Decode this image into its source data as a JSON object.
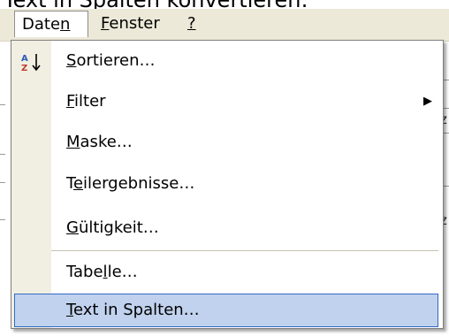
{
  "caption": "Text in Spalten konvertieren:",
  "menubar": {
    "daten": {
      "pre": "Date",
      "ul": "n",
      "post": ""
    },
    "fenster": {
      "pre": "",
      "ul": "F",
      "post": "enster"
    },
    "help": {
      "pre": "",
      "ul": "?",
      "post": ""
    }
  },
  "menu": {
    "items": [
      {
        "pre": "",
        "ul": "S",
        "post": "ortieren…",
        "icon": "sort-az-icon"
      },
      {
        "pre": "",
        "ul": "F",
        "post": "ilter",
        "submenu": "▶"
      },
      {
        "pre": "",
        "ul": "M",
        "post": "aske…"
      },
      {
        "pre": "T",
        "ul": "e",
        "post": "ilergebnisse…"
      },
      {
        "pre": "",
        "ul": "G",
        "post": "ültigkeit…"
      },
      {
        "pre": "Tabe",
        "ul": "l",
        "post": "le…"
      },
      {
        "pre": "",
        "ul": "T",
        "post": "ext in Spalten…"
      }
    ],
    "highlighted_index": 6
  },
  "background_fragments": {
    "right_1": "z",
    "right_2": "z",
    "arrow_char": "▾"
  },
  "colors": {
    "menu_highlight": "#c1d2ee",
    "highlight_border": "#316ac5",
    "gutter": "#f1efe2",
    "menubar": "#ece9d8"
  }
}
